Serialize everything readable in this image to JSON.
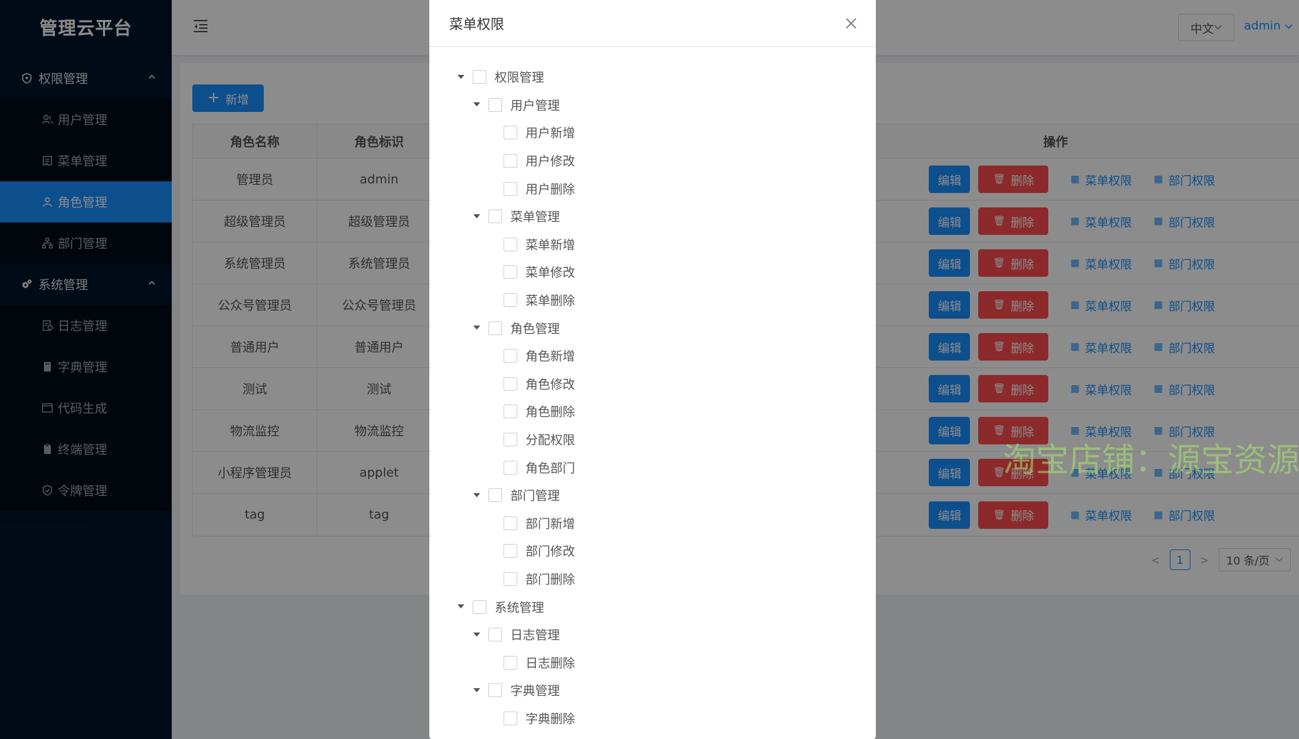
{
  "app": {
    "title": "管理云平台"
  },
  "sidebar": {
    "groups": [
      {
        "label": "权限管理",
        "items": [
          "用户管理",
          "菜单管理",
          "角色管理",
          "部门管理"
        ]
      },
      {
        "label": "系统管理",
        "items": [
          "日志管理",
          "字典管理",
          "代码生成",
          "终端管理",
          "令牌管理"
        ]
      }
    ],
    "active_item": "角色管理"
  },
  "header": {
    "lang": "中文",
    "user": "admin"
  },
  "toolbar": {
    "add_label": "新增"
  },
  "table": {
    "headers": [
      "角色名称",
      "角色标识",
      "操作"
    ],
    "rows": [
      [
        "管理员",
        "admin"
      ],
      [
        "超级管理员",
        "超级管理员"
      ],
      [
        "系统管理员",
        "系统管理员"
      ],
      [
        "公众号管理员",
        "公众号管理员"
      ],
      [
        "普通用户",
        "普通用户"
      ],
      [
        "测试",
        "测试"
      ],
      [
        "物流监控",
        "物流监控"
      ],
      [
        "小程序管理员",
        "applet"
      ],
      [
        "tag",
        "tag"
      ]
    ],
    "actions": {
      "edit": "编辑",
      "delete": "删除",
      "menu_perm": "菜单权限",
      "dept_perm": "部门权限"
    }
  },
  "pagination": {
    "current": "1",
    "page_size": "10 条/页"
  },
  "watermark": "淘宝店铺：源宝资源",
  "modal": {
    "title": "菜单权限",
    "tree": [
      {
        "label": "权限管理",
        "level": 1,
        "expandable": true
      },
      {
        "label": "用户管理",
        "level": 2,
        "expandable": true
      },
      {
        "label": "用户新增",
        "level": 3,
        "expandable": false
      },
      {
        "label": "用户修改",
        "level": 3,
        "expandable": false
      },
      {
        "label": "用户删除",
        "level": 3,
        "expandable": false
      },
      {
        "label": "菜单管理",
        "level": 2,
        "expandable": true
      },
      {
        "label": "菜单新增",
        "level": 3,
        "expandable": false
      },
      {
        "label": "菜单修改",
        "level": 3,
        "expandable": false
      },
      {
        "label": "菜单删除",
        "level": 3,
        "expandable": false
      },
      {
        "label": "角色管理",
        "level": 2,
        "expandable": true
      },
      {
        "label": "角色新增",
        "level": 3,
        "expandable": false
      },
      {
        "label": "角色修改",
        "level": 3,
        "expandable": false
      },
      {
        "label": "角色删除",
        "level": 3,
        "expandable": false
      },
      {
        "label": "分配权限",
        "level": 3,
        "expandable": false
      },
      {
        "label": "角色部门",
        "level": 3,
        "expandable": false
      },
      {
        "label": "部门管理",
        "level": 2,
        "expandable": true
      },
      {
        "label": "部门新增",
        "level": 3,
        "expandable": false
      },
      {
        "label": "部门修改",
        "level": 3,
        "expandable": false
      },
      {
        "label": "部门删除",
        "level": 3,
        "expandable": false
      },
      {
        "label": "系统管理",
        "level": 1,
        "expandable": true
      },
      {
        "label": "日志管理",
        "level": 2,
        "expandable": true
      },
      {
        "label": "日志删除",
        "level": 3,
        "expandable": false
      },
      {
        "label": "字典管理",
        "level": 2,
        "expandable": true
      },
      {
        "label": "字典删除",
        "level": 3,
        "expandable": false
      }
    ]
  },
  "colors": {
    "primary": "#1890ff",
    "danger": "#ff4d4f",
    "sidebar_bg": "#001529"
  }
}
